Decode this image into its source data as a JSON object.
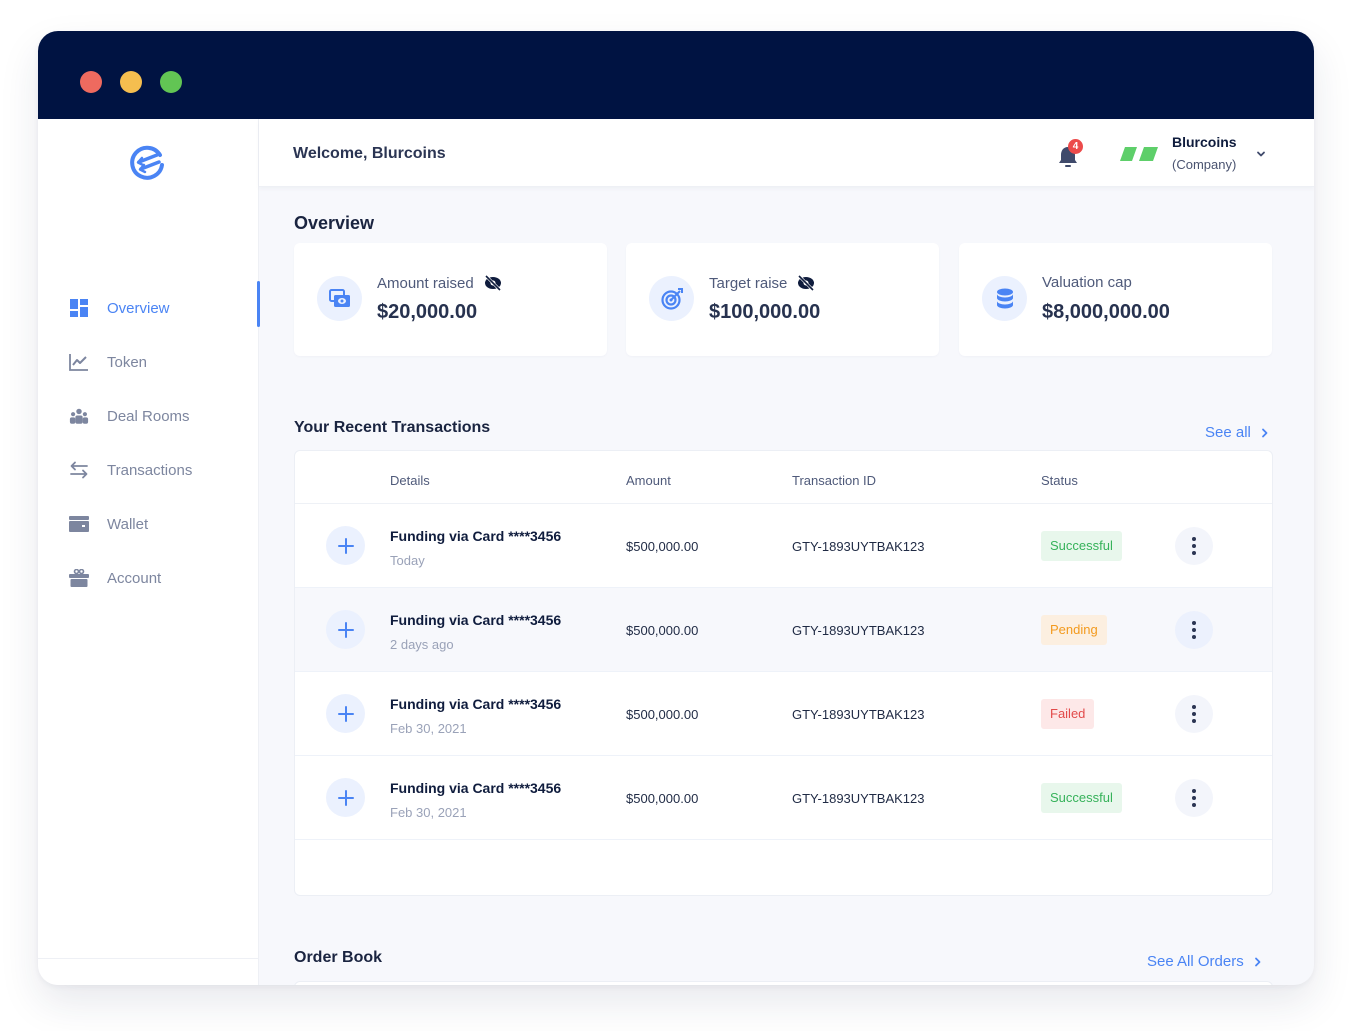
{
  "window": {
    "controls": [
      "close",
      "minimize",
      "maximize"
    ]
  },
  "sidebar": {
    "logo": "brand-logo",
    "items": [
      {
        "label": "Overview",
        "icon": "dashboard-icon",
        "active": true
      },
      {
        "label": "Token",
        "icon": "chart-line-icon",
        "active": false
      },
      {
        "label": "Deal Rooms",
        "icon": "users-icon",
        "active": false
      },
      {
        "label": "Transactions",
        "icon": "swap-arrows-icon",
        "active": false
      },
      {
        "label": "Wallet",
        "icon": "wallet-icon",
        "active": false
      },
      {
        "label": "Account",
        "icon": "gift-box-icon",
        "active": false
      }
    ]
  },
  "header": {
    "welcome": "Welcome, Blurcoins",
    "notifications_count": "4",
    "user_name": "Blurcoins",
    "user_role": "(Company)"
  },
  "overview": {
    "title": "Overview",
    "cards": [
      {
        "label": "Amount raised",
        "value": "$20,000.00",
        "icon": "money-icon",
        "hidden_toggle": true
      },
      {
        "label": "Target raise",
        "value": "$100,000.00",
        "icon": "target-icon",
        "hidden_toggle": true
      },
      {
        "label": "Valuation cap",
        "value": "$8,000,000.00",
        "icon": "database-icon",
        "hidden_toggle": false
      }
    ]
  },
  "transactions": {
    "title": "Your Recent Transactions",
    "see_all": "See all",
    "columns": [
      "Details",
      "Amount",
      "Transaction ID",
      "Status"
    ],
    "rows": [
      {
        "name": "Funding via Card ****3456",
        "date": "Today",
        "amount": "$500,000.00",
        "id": "GTY-1893UYTBAK123",
        "status": "Successful"
      },
      {
        "name": "Funding via Card ****3456",
        "date": "2 days ago",
        "amount": "$500,000.00",
        "id": "GTY-1893UYTBAK123",
        "status": "Pending"
      },
      {
        "name": "Funding via Card ****3456",
        "date": "Feb 30, 2021",
        "amount": "$500,000.00",
        "id": "GTY-1893UYTBAK123",
        "status": "Failed"
      },
      {
        "name": "Funding via Card ****3456",
        "date": "Feb 30, 2021",
        "amount": "$500,000.00",
        "id": "GTY-1893UYTBAK123",
        "status": "Successful"
      }
    ]
  },
  "order_book": {
    "title": "Order Book",
    "see_all": "See All Orders"
  },
  "colors": {
    "accent": "#4a84f4",
    "titlebar": "#001342",
    "success": "#36b25a",
    "pending": "#f39a1d",
    "failed": "#e24a4a"
  }
}
